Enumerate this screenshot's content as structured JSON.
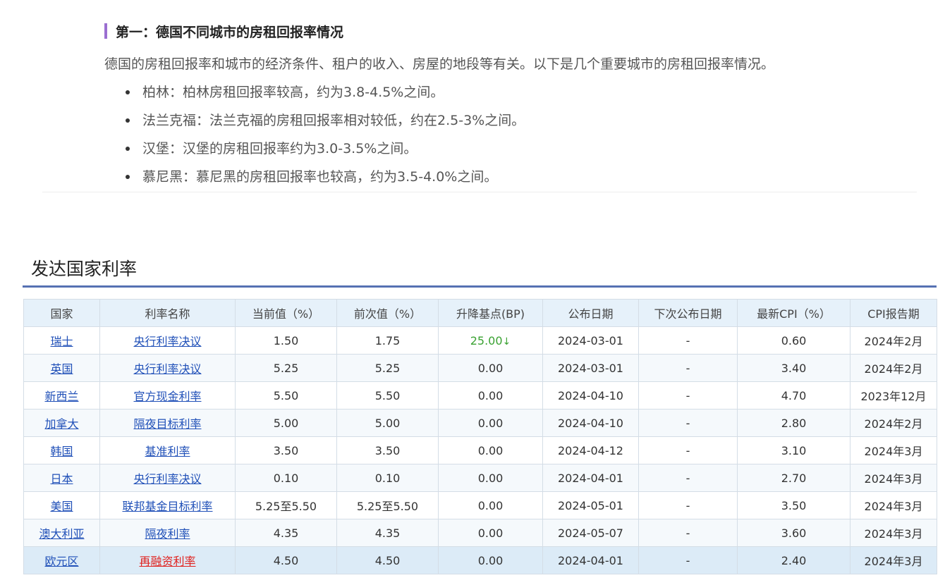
{
  "article": {
    "heading": "第一：德国不同城市的房租回报率情况",
    "intro": "德国的房租回报率和城市的经济条件、租户的收入、房屋的地段等有关。以下是几个重要城市的房租回报率情况。",
    "bullets": [
      "柏林：柏林房租回报率较高，约为3.8-4.5%之间。",
      "法兰克福：法兰克福的房租回报率相对较低，约在2.5-3%之间。",
      "汉堡：汉堡的房租回报率约为3.0-3.5%之间。",
      "慕尼黑：慕尼黑的房租回报率也较高，约为3.5-4.0%之间。"
    ]
  },
  "rates": {
    "title": "发达国家利率",
    "headers": [
      "国家",
      "利率名称",
      "当前值（%）",
      "前次值（%）",
      "升降基点(BP)",
      "公布日期",
      "下次公布日期",
      "最新CPI（%）",
      "CPI报告期"
    ],
    "rows": [
      {
        "country": "瑞士",
        "rate_name": "央行利率决议",
        "current": "1.50",
        "previous": "1.75",
        "change": "25.00",
        "change_arrow": "↓",
        "date": "2024-03-01",
        "next_date": "-",
        "cpi": "0.60",
        "cpi_period": "2024年2月"
      },
      {
        "country": "英国",
        "rate_name": "央行利率决议",
        "current": "5.25",
        "previous": "5.25",
        "change": "0.00",
        "change_arrow": "",
        "date": "2024-03-01",
        "next_date": "-",
        "cpi": "3.40",
        "cpi_period": "2024年2月"
      },
      {
        "country": "新西兰",
        "rate_name": "官方现金利率",
        "current": "5.50",
        "previous": "5.50",
        "change": "0.00",
        "change_arrow": "",
        "date": "2024-04-10",
        "next_date": "-",
        "cpi": "4.70",
        "cpi_period": "2023年12月"
      },
      {
        "country": "加拿大",
        "rate_name": "隔夜目标利率",
        "current": "5.00",
        "previous": "5.00",
        "change": "0.00",
        "change_arrow": "",
        "date": "2024-04-10",
        "next_date": "-",
        "cpi": "2.80",
        "cpi_period": "2024年2月"
      },
      {
        "country": "韩国",
        "rate_name": "基准利率",
        "current": "3.50",
        "previous": "3.50",
        "change": "0.00",
        "change_arrow": "",
        "date": "2024-04-12",
        "next_date": "-",
        "cpi": "3.10",
        "cpi_period": "2024年3月"
      },
      {
        "country": "日本",
        "rate_name": "央行利率决议",
        "current": "0.10",
        "previous": "0.10",
        "change": "0.00",
        "change_arrow": "",
        "date": "2024-04-01",
        "next_date": "-",
        "cpi": "2.70",
        "cpi_period": "2024年3月"
      },
      {
        "country": "美国",
        "rate_name": "联邦基金目标利率",
        "current": "5.25至5.50",
        "previous": "5.25至5.50",
        "change": "0.00",
        "change_arrow": "",
        "date": "2024-05-01",
        "next_date": "-",
        "cpi": "3.50",
        "cpi_period": "2024年3月"
      },
      {
        "country": "澳大利亚",
        "rate_name": "隔夜利率",
        "current": "4.35",
        "previous": "4.35",
        "change": "0.00",
        "change_arrow": "",
        "date": "2024-05-07",
        "next_date": "-",
        "cpi": "3.60",
        "cpi_period": "2024年3月"
      },
      {
        "country": "欧元区",
        "rate_name": "再融资利率",
        "current": "4.50",
        "previous": "4.50",
        "change": "0.00",
        "change_arrow": "",
        "date": "2024-04-01",
        "next_date": "-",
        "cpi": "2.40",
        "cpi_period": "2024年3月"
      }
    ]
  },
  "colors": {
    "heading_accent": "#9b6fd1",
    "link": "#2050b8",
    "link_highlight": "#e0221f",
    "rate_cut": "#3aa232",
    "table_rule": "#5671b3"
  }
}
